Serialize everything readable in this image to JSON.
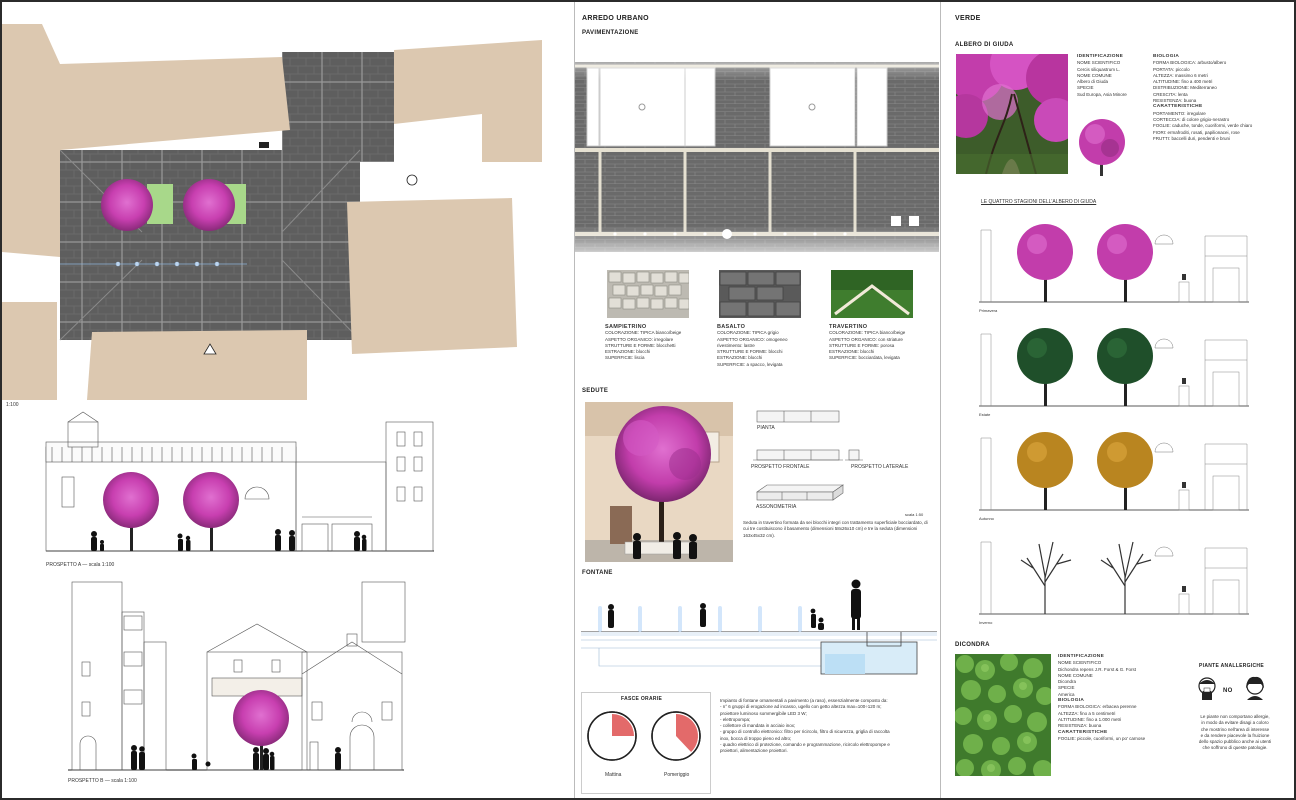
{
  "colors": {
    "blossom": "#c83fb0",
    "building": "#dcc8b0",
    "paving": "#5e5e5e",
    "summer": "#1f4f2a",
    "autumn": "#b98520",
    "grass": "#5a9a3c",
    "gauge_red": "#e36a6a"
  },
  "left": {
    "plan_scale": "1:100",
    "elevation_a_caption": "PROSPETTO A — scala 1:100",
    "elevation_b_caption": "PROSPETTO B — scala 1:100"
  },
  "middle": {
    "title": "ARREDO URBANO",
    "paving_title": "PAVIMENTAZIONE",
    "materials": [
      {
        "name": "SAMPIETRINO",
        "lines": [
          "COLORAZIONE: TIPICA bianco/beige",
          "ASPETTO ORGANICO: irregolare",
          "STRUTTURE E FORME: blocchetti",
          "ESTRAZIONE: blocchi",
          "SUPERFICIE: liscia"
        ]
      },
      {
        "name": "BASALTO",
        "lines": [
          "COLORAZIONE: TIPICA grigio",
          "ASPETTO ORGANICO: omogeneo",
          "rivestimento: lastre",
          "STRUTTURE E FORME: blocchi",
          "ESTRAZIONE: blocchi",
          "SUPERFICIE: a spacco, levigata"
        ]
      },
      {
        "name": "TRAVERTINO",
        "lines": [
          "COLORAZIONE: TIPICA bianco/beige",
          "ASPETTO ORGANICO: con striature",
          "STRUTTURE E FORME: porosa",
          "ESTRAZIONE: blocchi",
          "SUPERFICIE: bocciardata, levigata"
        ]
      }
    ],
    "seats_title": "SEDUTE",
    "seat_views": {
      "plan": "PIANTA",
      "front": "PROSPETTO FRONTALE",
      "side": "PROSPETTO LATERALE",
      "axo": "ASSONOMETRIA",
      "scale": "scala 1:50"
    },
    "seat_description": "Seduta in travertino formata da sei blocchi integri con trattamento superficiale bocciardato, di cui tre costituiscono il basamento (dimensioni 58x26x10 cm) e tre la seduta (dimensioni 163x45x32 cm).",
    "fountains_title": "FONTANE",
    "schedule_title": "FASCE ORARIE",
    "gauge_labels": [
      "Mattina",
      "Pomeriggio"
    ],
    "gauge_fractions": [
      0.25,
      0.38
    ],
    "fountain_description": [
      "Impianto di fontane ornamentali a pavimento (a raso), essenzialmente composto da:",
      "- n° 6 gruppi di erogazione ad incasso, ugello con getto altezza max=100÷120 m;",
      "  proiettore luminoso sommergibile LED 3 W;",
      "- elettropompa;",
      "- collettore di mandata in acciaio inox;",
      "- gruppo di controllo elettronico: filtro per ricircolo, filtro di sicurezza, griglia di raccolta",
      "  inox, bocca di troppo pieno ed altro;",
      "- quadro elettrico di protezione, comando e programmazione, ricircolo elettropompe e",
      "  proiettori, alimentazione proiettori."
    ]
  },
  "right": {
    "title": "VERDE",
    "tree_title": "ALBERO DI GIUDA",
    "id_col": [
      "IDENTIFICAZIONE",
      "NOME SCIENTIFICO",
      "Cercis siliquastrum L.",
      "NOME COMUNE",
      "Albero di Giuda",
      "SPECIE",
      "Sud Europa, Asia Minore"
    ],
    "bio_col": [
      "BIOLOGIA",
      "FORMA BIOLOGICA: arbusto/albero",
      "PORTATA: piccolo",
      "ALTEZZA: massimo 6 metri",
      "ALTITUDINE: fino a 400 metri",
      "DISTRIBUZIONE: Mediterraneo",
      "CRESCITA: lenta",
      "RESISTENZA: buona",
      "CARATTERISTICHE",
      "PORTAMENTO: irregolare",
      "CORTECCIA: di colore grigio-nerastro",
      "FOGLIE: caduche, tonde, cuoriformi, verde chiaro",
      "FIORI: ermafroditi, rosati, papilionacei, rose",
      "FRUTTI: baccelli duri, pendenti e bruni"
    ],
    "seasons_title": "LE QUATTRO STAGIONI DELL'ALBERO DI GIUDA",
    "seasons": [
      "Primavera",
      "Estate",
      "Autunno",
      "Inverno"
    ],
    "ground_title": "DICONDRA",
    "ground_info": [
      "IDENTIFICAZIONE",
      "NOME SCIENTIFICO",
      "Dichondra repens J.R. Forst & G. Forst",
      "NOME COMUNE",
      "Dicondra",
      "SPECIE",
      "America",
      "BIOLOGIA",
      "FORMA BIOLOGICA: erbacea perenne",
      "ALTEZZA: fino a 5 centimetri",
      "ALTITUDINE: fino a 1.000 metri",
      "RESISTENZA: buona",
      "CARATTERISTICHE",
      "FOGLIE: piccole, cuoriformi, un po' carnose"
    ],
    "allergy_title": "PIANTE ANALLERGICHE",
    "allergy_no": "NO",
    "allergy_text": [
      "Le piante non comportano allergie,",
      "in modo da evitare disagi a coloro",
      "che mostrino nell'area di interesse",
      "e da rendere piacevole la fruizione",
      "dello spazio pubblico anche ai utenti",
      "che soffrono di queste patologie."
    ]
  }
}
